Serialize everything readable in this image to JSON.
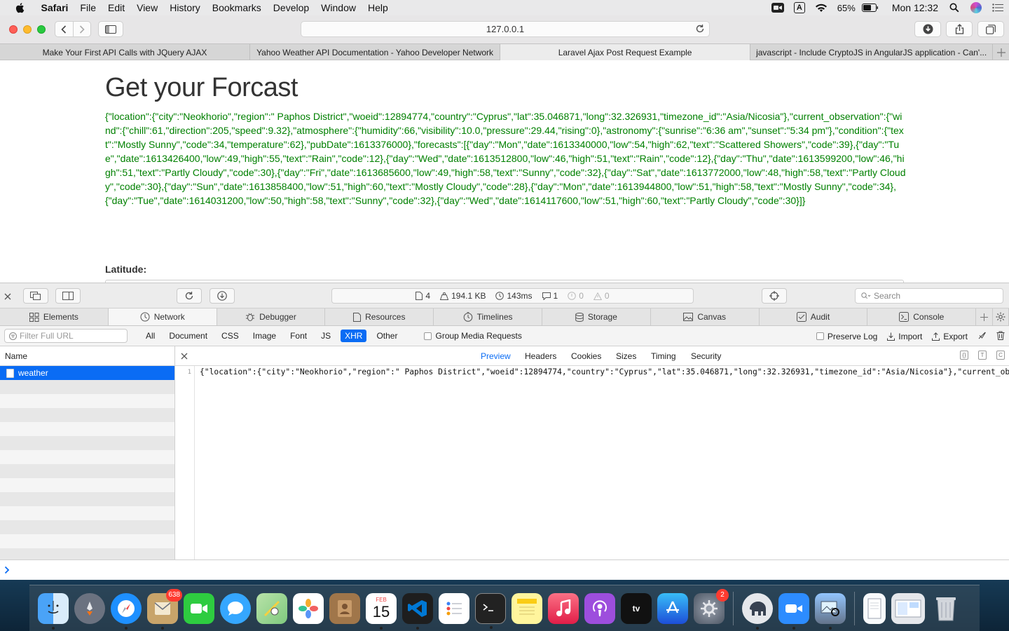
{
  "menubar": {
    "app_name": "Safari",
    "items": [
      "File",
      "Edit",
      "View",
      "History",
      "Bookmarks",
      "Develop",
      "Window",
      "Help"
    ],
    "battery": "65%",
    "clock": "Mon 12:32",
    "input_source": "A"
  },
  "toolbar": {
    "address": "127.0.0.1"
  },
  "tabs": [
    {
      "label": "Make Your First API Calls with JQuery AJAX"
    },
    {
      "label": "Yahoo Weather API Documentation - Yahoo Developer Network"
    },
    {
      "label": "Laravel Ajax Post Request Example"
    },
    {
      "label": "javascript - Include CryptoJS in AngularJS application - Can'..."
    }
  ],
  "page": {
    "title": "Get your Forcast",
    "json_output": "{\"location\":{\"city\":\"Neokhorio\",\"region\":\" Paphos District\",\"woeid\":12894774,\"country\":\"Cyprus\",\"lat\":35.046871,\"long\":32.326931,\"timezone_id\":\"Asia/Nicosia\"},\"current_observation\":{\"wind\":{\"chill\":61,\"direction\":205,\"speed\":9.32},\"atmosphere\":{\"humidity\":66,\"visibility\":10.0,\"pressure\":29.44,\"rising\":0},\"astronomy\":{\"sunrise\":\"6:36 am\",\"sunset\":\"5:34 pm\"},\"condition\":{\"text\":\"Mostly Sunny\",\"code\":34,\"temperature\":62},\"pubDate\":1613376000},\"forecasts\":[{\"day\":\"Mon\",\"date\":1613340000,\"low\":54,\"high\":62,\"text\":\"Scattered Showers\",\"code\":39},{\"day\":\"Tue\",\"date\":1613426400,\"low\":49,\"high\":55,\"text\":\"Rain\",\"code\":12},{\"day\":\"Wed\",\"date\":1613512800,\"low\":46,\"high\":51,\"text\":\"Rain\",\"code\":12},{\"day\":\"Thu\",\"date\":1613599200,\"low\":46,\"high\":51,\"text\":\"Partly Cloudy\",\"code\":30},{\"day\":\"Fri\",\"date\":1613685600,\"low\":49,\"high\":58,\"text\":\"Sunny\",\"code\":32},{\"day\":\"Sat\",\"date\":1613772000,\"low\":48,\"high\":58,\"text\":\"Partly Cloudy\",\"code\":30},{\"day\":\"Sun\",\"date\":1613858400,\"low\":51,\"high\":60,\"text\":\"Mostly Cloudy\",\"code\":28},{\"day\":\"Mon\",\"date\":1613944800,\"low\":51,\"high\":58,\"text\":\"Mostly Sunny\",\"code\":34},{\"day\":\"Tue\",\"date\":1614031200,\"low\":50,\"high\":58,\"text\":\"Sunny\",\"code\":32},{\"day\":\"Wed\",\"date\":1614117600,\"low\":51,\"high\":60,\"text\":\"Partly Cloudy\",\"code\":30}]}",
    "latitude_label": "Latitude:"
  },
  "inspector": {
    "activity": {
      "resources": "4",
      "size": "194.1 KB",
      "time": "143ms",
      "logs": "1",
      "errors": "0",
      "warnings": "0"
    },
    "search_placeholder": "Search",
    "tabs": [
      "Elements",
      "Network",
      "Debugger",
      "Resources",
      "Timelines",
      "Storage",
      "Canvas",
      "Audit",
      "Console"
    ],
    "filter_placeholder": "Filter Full URL",
    "types": [
      "All",
      "Document",
      "CSS",
      "Image",
      "Font",
      "JS",
      "XHR",
      "Other"
    ],
    "active_type": "XHR",
    "group_media": "Group Media Requests",
    "preserve_log": "Preserve Log",
    "import": "Import",
    "export": "Export",
    "name_header": "Name",
    "requests": [
      {
        "name": "weather"
      }
    ],
    "detail_tabs": [
      "Preview",
      "Headers",
      "Cookies",
      "Sizes",
      "Timing",
      "Security"
    ],
    "active_detail_tab": "Preview",
    "line_number": "1",
    "preview_text": "{\"location\":{\"city\":\"Neokhorio\",\"region\":\" Paphos District\",\"woeid\":12894774,\"country\":\"Cyprus\",\"lat\":35.046871,\"long\":32.326931,\"timezone_id\":\"Asia/Nicosia\"},\"current_observa"
  },
  "dock": {
    "badges": {
      "mail": "638",
      "system_preferences": "2"
    },
    "calendar_month": "FEB",
    "calendar_day": "15",
    "colors": {
      "finder": "#3a8ef0",
      "launchpad": "#6b7280",
      "safari": "#1e90ff",
      "facetime": "#2ecc40",
      "messages": "#35a7ff",
      "maps": "#7fc97f",
      "vscode": "#0078d4",
      "terminal": "#222222",
      "zoom": "#2d8cff"
    }
  }
}
